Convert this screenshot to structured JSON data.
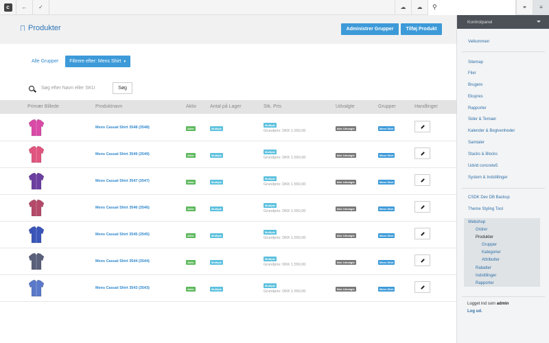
{
  "toolbar": {
    "search_icon": "search-icon",
    "left_icons": [
      "app-logo-icon",
      "back-arrow-icon",
      "check-icon"
    ],
    "right_icons": [
      "cloud-download-icon",
      "cloud-upload-icon",
      "share-icon",
      "sliders-icon"
    ]
  },
  "page": {
    "title": "Produkter",
    "btn_manage_groups": "Administrer Grupper",
    "btn_add_product": "Tilføj Produkt"
  },
  "filters": {
    "all_groups": "Alle Grupper",
    "filter_label": "Filtrere efter: Mens Shirt"
  },
  "search": {
    "placeholder": "Søg efter Navn eller SKU",
    "button": "Søg"
  },
  "table": {
    "headers": [
      "Primær Billede",
      "Produktnavn",
      "Aktiv",
      "Antal på Lager",
      "Stk. Pris",
      "Udvalgte",
      "Grupper",
      "Handlinger"
    ],
    "rows": [
      {
        "name": "Mens Casual Shirt 3548 (3548)",
        "active": "Aktiv",
        "stock": "Multiple",
        "price_badge": "Multiple",
        "price": "Grundpris: DKK 1.550,00",
        "featured": "Ikke Udvalgte",
        "group": "Mens Shirt",
        "color": "#d94aa6"
      },
      {
        "name": "Mens Casual Shirt 3549 (3549)",
        "active": "Aktiv",
        "stock": "Multiple",
        "price_badge": "Multiple",
        "price": "Grundpris: DKK 1.550,00",
        "featured": "Ikke Udvalgte",
        "group": "Mens Shirt",
        "color": "#e0557f"
      },
      {
        "name": "Mens Casual Shirt 3547 (3547)",
        "active": "Aktiv",
        "stock": "Multiple",
        "price_badge": "Multiple",
        "price": "Grundpris: DKK 1.550,00",
        "featured": "Ikke Udvalgte",
        "group": "Mens Shirt",
        "color": "#6b3fa0"
      },
      {
        "name": "Mens Casual Shirt 3546 (3546)",
        "active": "Aktiv",
        "stock": "Multiple",
        "price_badge": "Multiple",
        "price": "Grundpris: DKK 1.550,00",
        "featured": "Ikke Udvalgte",
        "group": "Mens Shirt",
        "color": "#b44a6a"
      },
      {
        "name": "Mens Casual Shirt 3545 (3545)",
        "active": "Aktiv",
        "stock": "Multiple",
        "price_badge": "Multiple",
        "price": "Grundpris: DKK 1.550,00",
        "featured": "Ikke Udvalgte",
        "group": "Mens Shirt",
        "color": "#3a55b8"
      },
      {
        "name": "Mens Casual Shirt 3544 (3544)",
        "active": "Aktiv",
        "stock": "Multiple",
        "price_badge": "Multiple",
        "price": "Grundpris: DKK 1.550,00",
        "featured": "Ikke Udvalgte",
        "group": "Mens Shirt",
        "color": "#5a5f7a"
      },
      {
        "name": "Mens Casual Shirt 3543 (3543)",
        "active": "Aktiv",
        "stock": "Multiple",
        "price_badge": "Multiple",
        "price": "Grundpris: DKK 1.550,00",
        "featured": "Ikke Udvalgte",
        "group": "Mens Shirt",
        "color": "#5b79c9"
      }
    ]
  },
  "sidebar": {
    "header": "Kontrolpanel",
    "welcome": "Velkommen",
    "items": [
      "Sitemap",
      "Filer",
      "Brugere",
      "Ekspres",
      "Rapporter",
      "Sider & Temaer",
      "Kalender & Begivenheder",
      "Samtaler",
      "Stacks & Blocks",
      "Udvid concrete5",
      "System & Indstillinger"
    ],
    "extras": [
      "CSDK Dev DB Backup",
      "Theme Styling Tool"
    ],
    "webshop": {
      "label": "Webshop",
      "ordrer": "Ordrer",
      "produkter": "Produkter",
      "grupper": "Grupper",
      "kategorier": "Kategorier",
      "attributter": "Attributter",
      "rabatter": "Rabatter",
      "indstillinger": "Indstillinger",
      "rapporter": "Rapporter"
    },
    "logged_in": "Logget ind som",
    "user": "admin",
    "logout": "Log ud."
  }
}
